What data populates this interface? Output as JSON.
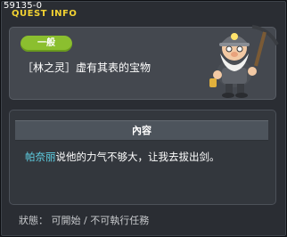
{
  "window": {
    "id": "59135-0",
    "title": "QUEST INFO",
    "close_icon": "close-icon"
  },
  "quest": {
    "category_badge": "一般",
    "name": "［林之灵］虚有其表的宝物",
    "npc_image": "old-miner-npc"
  },
  "content": {
    "header": "內容",
    "npc_name": "帕奈丽",
    "text": "说他的力气不够大，让我去拔出剑。"
  },
  "status": {
    "text": "狀態： 可開始 / 不可執行任務"
  },
  "colors": {
    "title": "#f2d232",
    "badge": "#8bbf2f",
    "npc_name": "#5fd2e6"
  }
}
